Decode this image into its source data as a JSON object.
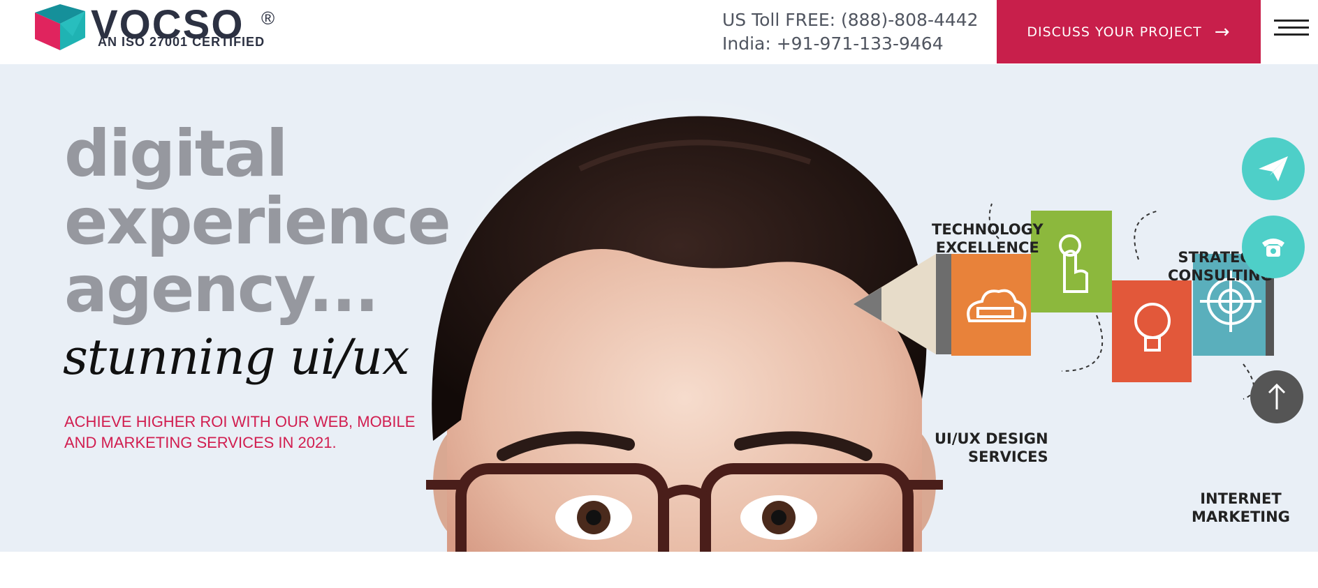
{
  "header": {
    "logo_word": "VOCSO",
    "logo_reg": "®",
    "logo_sub": "AN ISO 27001 CERTIFIED",
    "phone_us": "US Toll FREE: (888)-808-4442",
    "phone_india": "India: +91-971-133-9464",
    "cta_label": "DISCUSS YOUR PROJECT",
    "cta_arrow": "→"
  },
  "hero": {
    "headline": [
      "digital",
      "experience",
      "agency..."
    ],
    "script": "stunning ui/ux",
    "tagline": "ACHIEVE HIGHER ROI WITH OUR WEB, MOBILE AND MARKETING SERVICES IN 2021."
  },
  "diagram": {
    "labels": {
      "technology": [
        "TECHNOLOGY",
        "EXCELLENCE"
      ],
      "strategy": [
        "STRATEGY",
        "CONSULTING"
      ],
      "uiux": [
        "UI/UX DESIGN",
        "SERVICES"
      ],
      "internet": [
        "INTERNET",
        "MARKETING"
      ]
    }
  },
  "colors": {
    "brand_red": "#c81f4b",
    "teal": "#4ecfc8",
    "hero_bg": "#e9eff6",
    "orange": "#e8823a",
    "green": "#8cb83d",
    "red_orange": "#e2583a",
    "blue_teal": "#5aafbc"
  },
  "icons": {
    "send": "paper-plane-icon",
    "phone": "phone-icon",
    "top": "arrow-up-icon",
    "menu": "hamburger-menu-icon"
  }
}
